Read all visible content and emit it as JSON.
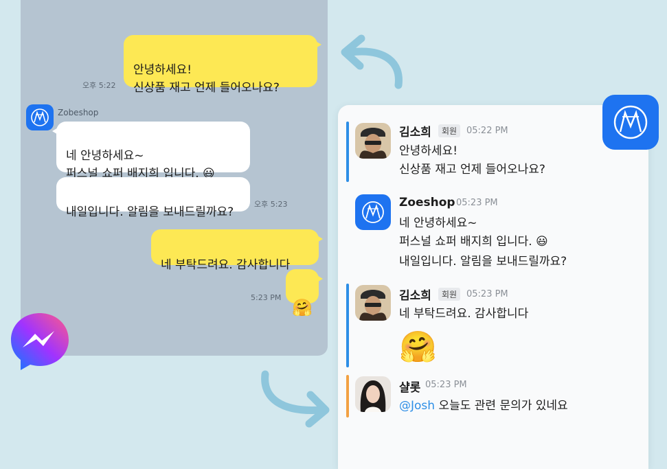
{
  "left_chat": {
    "msg1": "안녕하세요!\n신상품 재고 언제 들어오나요?",
    "msg1_time": "오후 5:22",
    "bot_name": "Zobeshop",
    "reply1": "네 안녕하세요~\n퍼스널 쇼퍼 배지희 입니다. 😃",
    "reply2": "내일입니다. 알림을 보내드릴까요?",
    "reply_time": "오후 5:23",
    "msg2": "네 부탁드려요. 감사합니다",
    "msg3": "🤗",
    "msg3_time": "5:23 PM"
  },
  "right_chat": {
    "messages": [
      {
        "user": "김소희",
        "badge": "회원",
        "time": "05:22 PM",
        "text": "안녕하세요!\n신상품 재고 언제 들어오나요?"
      },
      {
        "user": "Zoeshop",
        "time": "05:23 PM",
        "text": "네 안녕하세요~\n퍼스널 쇼퍼 배지희 입니다. 😃",
        "text2": "내일입니다. 알림을 보내드릴까요?"
      },
      {
        "user": "김소희",
        "badge": "회원",
        "time": "05:23 PM",
        "text": "네 부탁드려요. 감사합니다",
        "emoji": "🤗"
      },
      {
        "user": "샬롯",
        "time": "05:23 PM",
        "mention": "@Josh",
        "text": " 오늘도 관련 문의가 있네요"
      }
    ]
  },
  "icons": {
    "brand_logo": "zoeshop-logo-icon",
    "messenger": "facebook-messenger-icon",
    "arrow_top": "curved-arrow-left-icon",
    "arrow_bottom": "curved-arrow-right-icon"
  },
  "colors": {
    "kakao_yellow": "#fde854",
    "brand_blue": "#1e73f0",
    "accent_blue": "#2d8ee6",
    "accent_orange": "#f2a142"
  }
}
